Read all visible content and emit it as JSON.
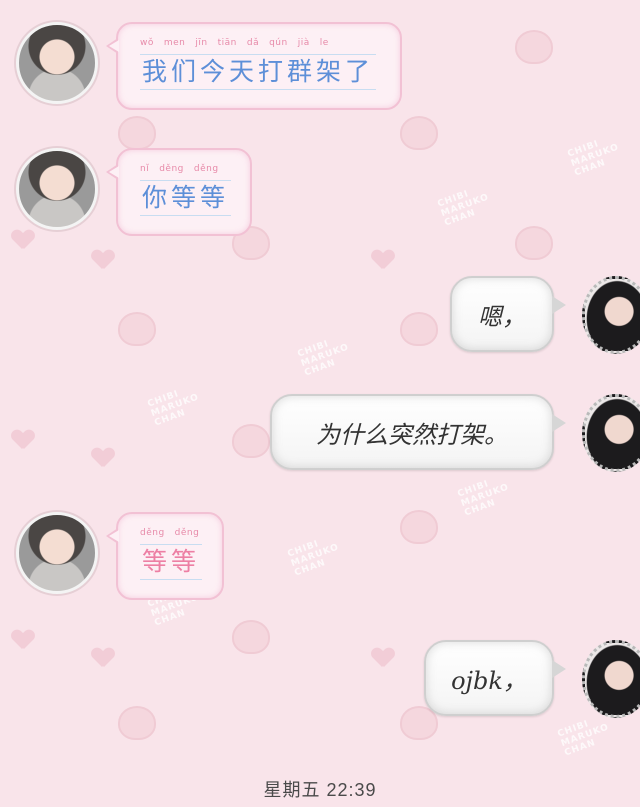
{
  "messages": [
    {
      "side": "left",
      "pinyin": [
        "wǒ",
        "men",
        "jīn",
        "tiān",
        "dǎ",
        "qún",
        "jià",
        "le"
      ],
      "text": "我们今天打群架了",
      "color": "blue"
    },
    {
      "side": "left",
      "pinyin": [
        "nǐ",
        "děng",
        "děng"
      ],
      "text": "你等等",
      "color": "blue"
    },
    {
      "side": "right",
      "text": "嗯，"
    },
    {
      "side": "right",
      "text": "为什么突然打架。"
    },
    {
      "side": "left",
      "pinyin": [
        "děng",
        "děng"
      ],
      "text": "等等",
      "color": "pink"
    },
    {
      "side": "right",
      "text": "ojbk，"
    }
  ],
  "footer": {
    "timestamp": "星期五 22:39"
  },
  "wallpaper": {
    "watermark": "CHIBI MARUKO CHAN"
  },
  "colors": {
    "background": "#f9e4ea",
    "pink_border": "#f2c1d4",
    "blue_text": "#5d8fd8",
    "pink_text": "#ed7fa4"
  }
}
